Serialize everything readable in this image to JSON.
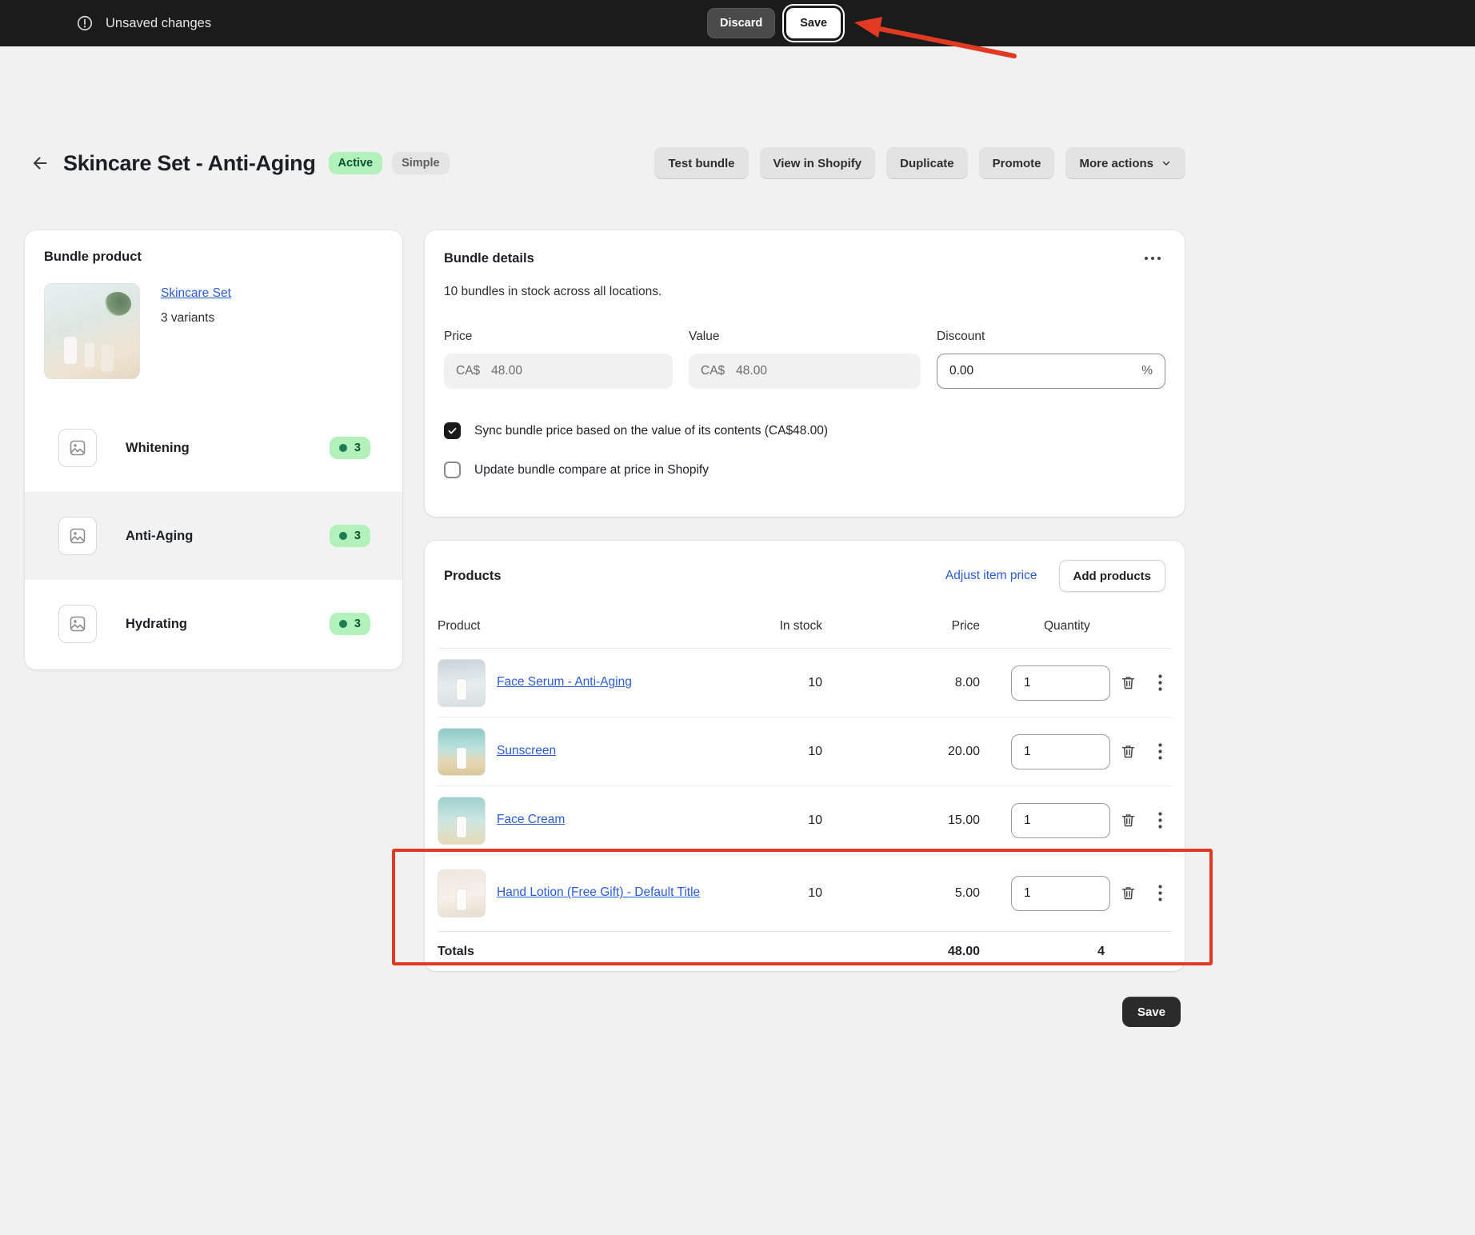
{
  "colors": {
    "annotation_red": "#e23a22",
    "link_blue": "#2a5bd8",
    "badge_success_bg": "#b2f1ba",
    "badge_success_text": "#0c5132",
    "topbar_bg": "#1b1b1b"
  },
  "topbar": {
    "status": "Unsaved changes",
    "discard_label": "Discard",
    "save_label": "Save"
  },
  "header": {
    "title": "Skincare Set - Anti-Aging",
    "status_badge": "Active",
    "type_badge": "Simple",
    "actions": {
      "test_bundle": "Test bundle",
      "view_in_shopify": "View in Shopify",
      "duplicate": "Duplicate",
      "promote": "Promote",
      "more_actions": "More actions"
    }
  },
  "bundle_product": {
    "title": "Bundle product",
    "product_link": "Skincare Set",
    "variants_count": "3 variants",
    "variants": [
      {
        "name": "Whitening",
        "count": "3",
        "selected": false
      },
      {
        "name": "Anti-Aging",
        "count": "3",
        "selected": true
      },
      {
        "name": "Hydrating",
        "count": "3",
        "selected": false
      }
    ]
  },
  "bundle_details": {
    "title": "Bundle details",
    "stock_text": "10 bundles in stock across all locations.",
    "price_label": "Price",
    "price_prefix": "CA$",
    "price_value": "48.00",
    "value_label": "Value",
    "value_prefix": "CA$",
    "value_value": "48.00",
    "discount_label": "Discount",
    "discount_value": "0.00",
    "discount_suffix": "%",
    "sync_checkbox": {
      "label": "Sync bundle price based on the value of its contents (CA$48.00)",
      "checked": true
    },
    "compare_checkbox": {
      "label": "Update bundle compare at price in Shopify",
      "checked": false
    }
  },
  "products": {
    "title": "Products",
    "adjust_link": "Adjust item price",
    "add_button": "Add products",
    "columns": {
      "product": "Product",
      "in_stock": "In stock",
      "price": "Price",
      "quantity": "Quantity"
    },
    "rows": [
      {
        "name": "Face Serum - Anti-Aging",
        "in_stock": "10",
        "price": "8.00",
        "quantity": "1"
      },
      {
        "name": "Sunscreen",
        "in_stock": "10",
        "price": "20.00",
        "quantity": "1"
      },
      {
        "name": "Face Cream",
        "in_stock": "10",
        "price": "15.00",
        "quantity": "1"
      },
      {
        "name": "Hand Lotion (Free Gift) - Default Title",
        "in_stock": "10",
        "price": "5.00",
        "quantity": "1",
        "annotated": true
      }
    ],
    "totals": {
      "label": "Totals",
      "price": "48.00",
      "quantity": "4"
    }
  },
  "footer": {
    "save_label": "Save"
  }
}
